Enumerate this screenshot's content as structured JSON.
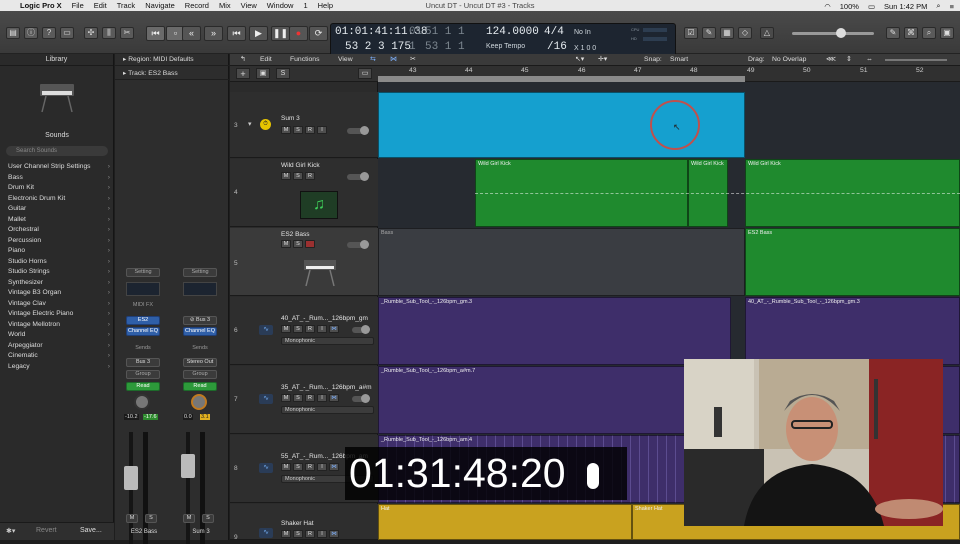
{
  "menubar": {
    "app": "Logic Pro X",
    "items": [
      "File",
      "Edit",
      "Track",
      "Navigate",
      "Record",
      "Mix",
      "View",
      "Window",
      "1",
      "Help"
    ],
    "window_title": "Uncut DT - Uncut DT #3 - Tracks",
    "battery": "100%",
    "clock": "Sun 1:42 PM"
  },
  "lcd": {
    "time_top": "01:01:41:11.38",
    "time_bottom": "53  2  3  175",
    "bars_top": "51  1  1",
    "bars_top_sub": "01",
    "bars_bottom": "53  1  1",
    "bars_bottom_sub": "1",
    "tempo": "124.0000",
    "tempo_label": "Keep Tempo",
    "signature": "4/4",
    "division": "/16",
    "in_label": "No In",
    "out_label": "X  1  0  0",
    "cpu_label": "CPU",
    "hd_label": "HD"
  },
  "library": {
    "title": "Library",
    "sounds_label": "Sounds",
    "search_placeholder": "Search Sounds",
    "items": [
      "User Channel Strip Settings",
      "Bass",
      "Drum Kit",
      "Electronic Drum Kit",
      "Guitar",
      "Mallet",
      "Orchestral",
      "Percussion",
      "Piano",
      "Studio Horns",
      "Studio Strings",
      "Synthesizer",
      "Vintage B3 Organ",
      "Vintage Clav",
      "Vintage Electric Piano",
      "Vintage Mellotron",
      "World",
      "Arpeggiator",
      "Cinematic",
      "Legacy"
    ],
    "revert": "Revert",
    "save": "Save..."
  },
  "inspector": {
    "region": "Region: MIDI Defaults",
    "track": "Track: ES2 Bass",
    "strip1": {
      "setting": "Setting",
      "midifx": "MIDI FX",
      "inst": "ES2",
      "eq": "Channel EQ",
      "sends": "Sends",
      "out": "Bus 3",
      "group": "Group",
      "auto": "Read",
      "vol": "-10.2",
      "peak": "-17.6",
      "name": "ES2 Bass"
    },
    "strip2": {
      "setting": "Setting",
      "bus": "Bus 3",
      "eq": "Channel EQ",
      "sends": "Sends",
      "out": "Stereo Out",
      "group": "Group",
      "auto": "Read",
      "vol": "0.0",
      "peak": "3.1",
      "name": "Sum 3"
    }
  },
  "tracksbar": {
    "edit": "Edit",
    "functions": "Functions",
    "view": "View",
    "snap_label": "Snap:",
    "snap": "Smart",
    "drag_label": "Drag:",
    "drag": "No Overlap"
  },
  "ruler": [
    43,
    44,
    45,
    46,
    47,
    48,
    49,
    50,
    51,
    52
  ],
  "tracks": [
    {
      "num": "3",
      "name": "Sum 3"
    },
    {
      "num": "4",
      "name": "Wild Girl Kick"
    },
    {
      "num": "5",
      "name": "ES2 Bass"
    },
    {
      "num": "6",
      "name": "40_AT_-_Rum..._126bpm_gm",
      "mode": "Monophonic"
    },
    {
      "num": "7",
      "name": "35_AT_-_Rum..._126bpm_a#m",
      "mode": "Monophonic"
    },
    {
      "num": "8",
      "name": "55_AT_-_Rum..._126bpm_am",
      "mode": "Monophonic"
    },
    {
      "num": "9",
      "name": "Shaker Hat"
    }
  ],
  "regions": {
    "kick1": "Wild Girl Kick",
    "kick2": "Wild Girl Kick",
    "kick3": "Wild Girl Kick",
    "bass1": "Bass",
    "bass2": "ES2 Bass",
    "r6a": "_Rumble_Sub_Tool_-_126bpm_gm.3",
    "r6b": "40_AT_-_Rumble_Sub_Tool_-_126bpm_gm.3",
    "r7a": "_Rumble_Sub_Tool_-_126bpm_a#m.7",
    "r8a": "_Rumble_Sub_Tool_-_126bpm_am.4",
    "r9a": "Hat",
    "r9b": "Shaker Hat"
  },
  "timecode": "01:31:48:20",
  "colors": {
    "sum": "#15a0cf",
    "kick": "#1f8a2e",
    "audio": "#3e2e6a",
    "hat": "#c9a21f"
  }
}
